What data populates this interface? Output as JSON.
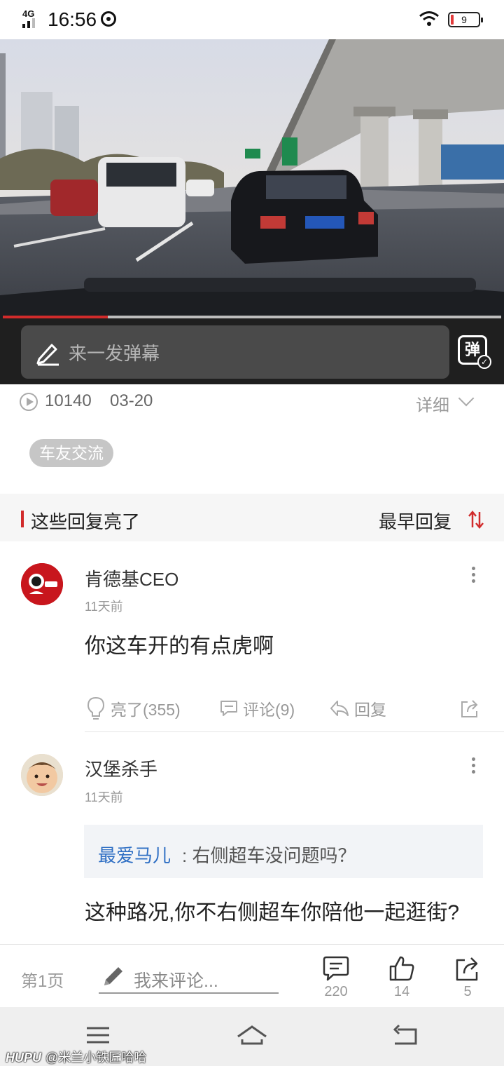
{
  "status_bar": {
    "network": "4G",
    "time": "16:56",
    "battery": "9"
  },
  "video": {
    "progress_percent": 21
  },
  "danmaku": {
    "placeholder": "来一发弹幕",
    "toggle_label": "弹"
  },
  "meta": {
    "views": "10140",
    "date": "03-20",
    "detail_label": "详细"
  },
  "tag": "车友交流",
  "section": {
    "title": "这些回复亮了",
    "sort_label": "最早回复"
  },
  "comments": [
    {
      "author": "肯德基CEO",
      "time": "11天前",
      "text": "你这车开的有点虎啊",
      "actions": {
        "light": "亮了(355)",
        "comment": "评论(9)",
        "reply": "回复"
      }
    },
    {
      "author": "汉堡杀手",
      "time": "11天前",
      "quote_author": "最爱马儿",
      "quote_text": ": 右侧超车没问题吗？",
      "text": "这种路况,你不右侧超车你陪他一起逛街?"
    }
  ],
  "comment_bar": {
    "page": "第1页",
    "placeholder": "我来评论...",
    "comment_count": "220",
    "like_count": "14",
    "share_count": "5"
  },
  "watermark": {
    "brand": "HUPU",
    "user": "@米兰小铁匠哈哈"
  },
  "colors": {
    "accent": "#d12b2b",
    "link": "#2f6fc4"
  }
}
